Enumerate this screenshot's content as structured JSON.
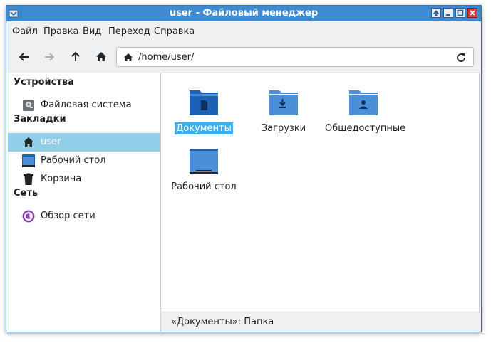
{
  "window": {
    "title": "user - Файловый менеджер"
  },
  "menubar": {
    "items": [
      "Файл",
      "Правка",
      "Вид",
      "Переход",
      "Справка"
    ]
  },
  "toolbar": {
    "back_icon": "arrow-left-icon",
    "forward_icon": "arrow-right-icon",
    "up_icon": "arrow-up-icon",
    "home_icon": "home-icon",
    "location_path": "/home/user/",
    "reload_icon": "reload-icon"
  },
  "sidebar": {
    "sections": [
      {
        "title": "Устройства",
        "items": [
          {
            "label": "Файловая система",
            "icon": "drive-icon"
          }
        ]
      },
      {
        "title": "Закладки",
        "items": [
          {
            "label": "user",
            "icon": "home-icon",
            "selected": true
          },
          {
            "label": "Рабочий стол",
            "icon": "desktop-icon"
          },
          {
            "label": "Корзина",
            "icon": "trash-icon"
          }
        ]
      },
      {
        "title": "Сеть",
        "items": [
          {
            "label": "Обзор сети",
            "icon": "network-icon"
          }
        ]
      }
    ]
  },
  "files": [
    {
      "label": "Документы",
      "icon": "folder-documents-icon",
      "selected": true
    },
    {
      "label": "Загрузки",
      "icon": "folder-downloads-icon"
    },
    {
      "label": "Общедоступные",
      "icon": "folder-public-icon"
    },
    {
      "label": "Рабочий стол",
      "icon": "folder-desktop-icon"
    }
  ],
  "statusbar": {
    "text": "«Документы»: Папка"
  },
  "colors": {
    "titlebar": "#3d8ad0",
    "selection_sidebar": "#93cee9",
    "selection_file": "#3daee9",
    "folder_blue": "#4a90d9",
    "folder_dark": "#1d61b5"
  }
}
